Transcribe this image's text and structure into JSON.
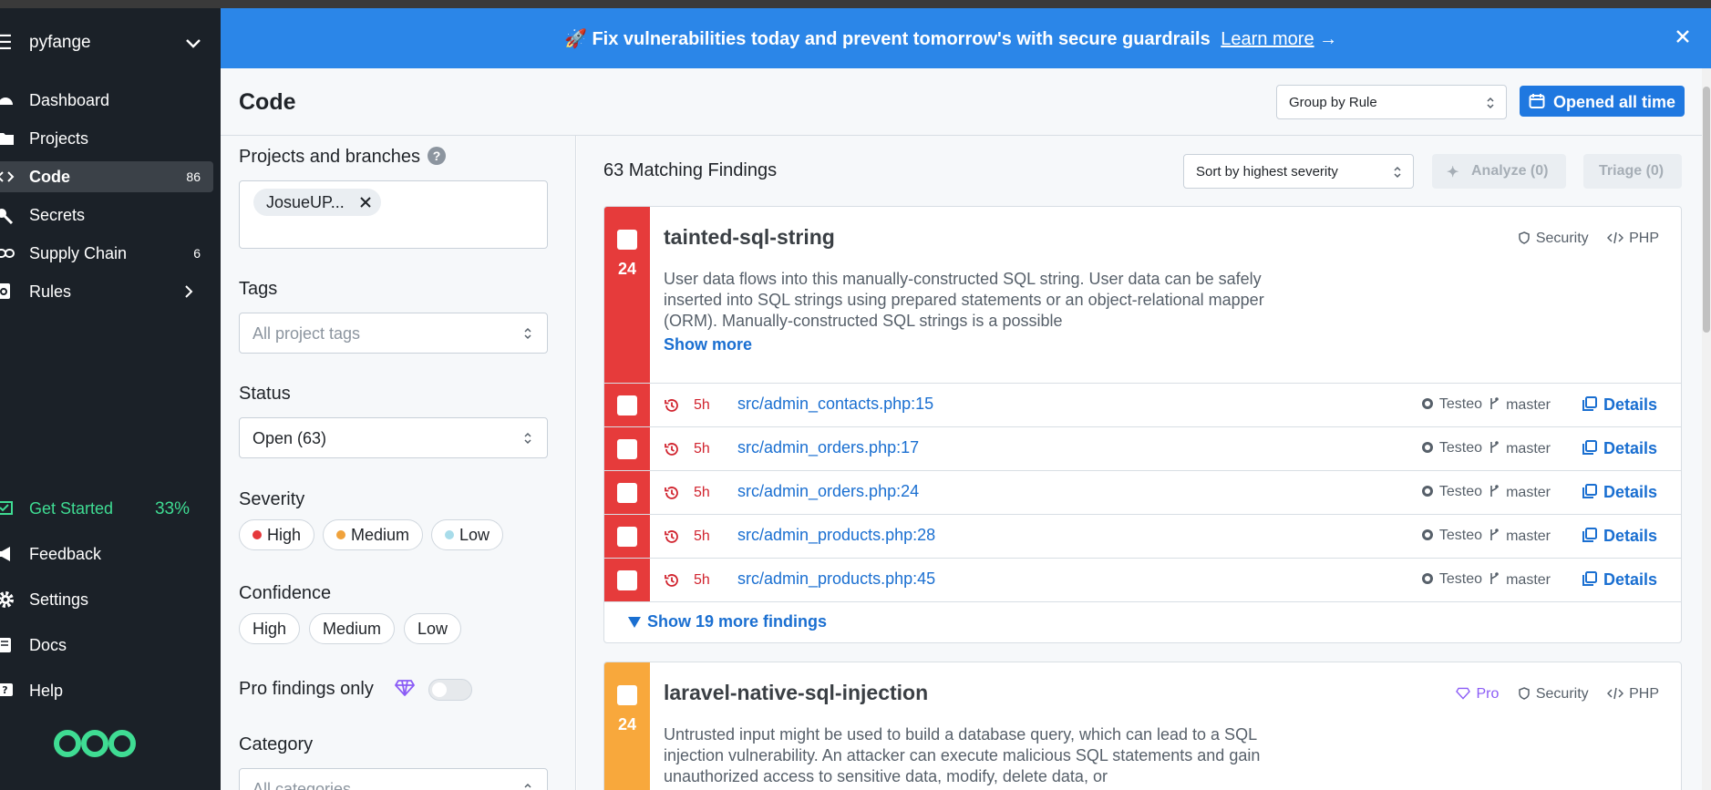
{
  "sidebar": {
    "org_name": "pyfange",
    "items": [
      {
        "label": "Dashboard",
        "count": ""
      },
      {
        "label": "Projects",
        "count": ""
      },
      {
        "label": "Code",
        "count": "86"
      },
      {
        "label": "Secrets",
        "count": ""
      },
      {
        "label": "Supply Chain",
        "count": "6"
      },
      {
        "label": "Rules",
        "count": ""
      }
    ],
    "get_started": {
      "label": "Get Started",
      "percent": "33%"
    },
    "bottom_items": [
      "Feedback",
      "Settings",
      "Docs",
      "Help"
    ]
  },
  "banner": {
    "text": "Fix vulnerabilities today and prevent tomorrow's with secure guardrails",
    "link": "Learn more",
    "link_arrow": "→"
  },
  "header": {
    "title": "Code",
    "group_select": "Group by Rule",
    "opened_button": "Opened all time"
  },
  "filters": {
    "projects_label": "Projects and branches",
    "help_glyph": "?",
    "project_chip": "JosueUP...",
    "tags_label": "Tags",
    "tags_placeholder": "All project tags",
    "status_label": "Status",
    "status_value": "Open (63)",
    "severity_label": "Severity",
    "severity_options": [
      {
        "label": "High",
        "color": "#e5383b"
      },
      {
        "label": "Medium",
        "color": "#f0a23b"
      },
      {
        "label": "Low",
        "color": "#a8dcea"
      }
    ],
    "confidence_label": "Confidence",
    "confidence_options": [
      "High",
      "Medium",
      "Low"
    ],
    "pro_label": "Pro findings only",
    "pro_enabled": false,
    "category_label": "Category",
    "category_placeholder": "All categories"
  },
  "results": {
    "count_text": "63 Matching Findings",
    "sort_select": "Sort by highest severity",
    "analyze_button": "Analyze (0)",
    "triage_button": "Triage (0)",
    "cards": [
      {
        "rule": "tainted-sql-string",
        "count": "24",
        "severity_color": "#e63b3b",
        "pro_tag": "",
        "category": "Security",
        "language": "PHP",
        "description": "User data flows into this manually-constructed SQL string. User data can be safely inserted into SQL strings using prepared statements or an object-relational mapper (ORM). Manually-constructed SQL strings is a possible",
        "show_more": "Show more",
        "findings": [
          {
            "age": "5h",
            "path": "src/admin_contacts.php:15",
            "repo": "Testeo",
            "branch": "master",
            "action": "Details"
          },
          {
            "age": "5h",
            "path": "src/admin_orders.php:17",
            "repo": "Testeo",
            "branch": "master",
            "action": "Details"
          },
          {
            "age": "5h",
            "path": "src/admin_orders.php:24",
            "repo": "Testeo",
            "branch": "master",
            "action": "Details"
          },
          {
            "age": "5h",
            "path": "src/admin_products.php:28",
            "repo": "Testeo",
            "branch": "master",
            "action": "Details"
          },
          {
            "age": "5h",
            "path": "src/admin_products.php:45",
            "repo": "Testeo",
            "branch": "master",
            "action": "Details"
          }
        ],
        "show_more_findings": "Show 19 more findings"
      },
      {
        "rule": "laravel-native-sql-injection",
        "count": "24",
        "severity_color": "#f8a83c",
        "pro_tag": "Pro",
        "category": "Security",
        "language": "PHP",
        "description": "Untrusted input might be used to build a database query, which can lead to a SQL injection vulnerability. An attacker can execute malicious SQL statements and gain unauthorized access to sensitive data, modify, delete data, or"
      }
    ]
  },
  "colors": {
    "sidebar_bg": "#1b2128",
    "banner_bg": "#2b86e8",
    "accent_blue": "#1f78e0",
    "get_started_green": "#3fdc93",
    "high_red": "#e63b3b",
    "medium_orange": "#f8a83c"
  }
}
